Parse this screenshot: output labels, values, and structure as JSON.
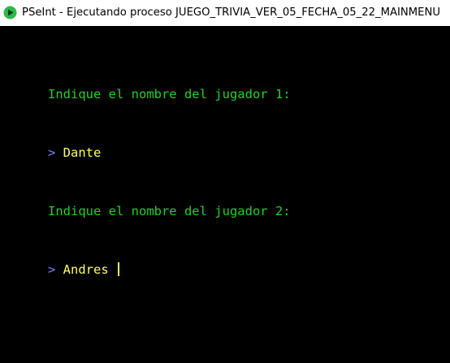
{
  "window": {
    "title": "PSeInt - Ejecutando proceso JUEGO_TRIVIA_VER_05_FECHA_05_22_MAINMENU",
    "icon": "pseint-app-icon"
  },
  "console": {
    "lines": [
      {
        "kind": "output",
        "text": "Indique el nombre del jugador 1:"
      },
      {
        "kind": "input",
        "prompt": "> ",
        "text": "Dante"
      },
      {
        "kind": "output",
        "text": "Indique el nombre del jugador 2:"
      },
      {
        "kind": "input",
        "prompt": "> ",
        "text": "Andres "
      }
    ]
  },
  "colors": {
    "output": "#22d02a",
    "prompt": "#7f7fff",
    "input": "#ffff66",
    "background": "#000000"
  }
}
